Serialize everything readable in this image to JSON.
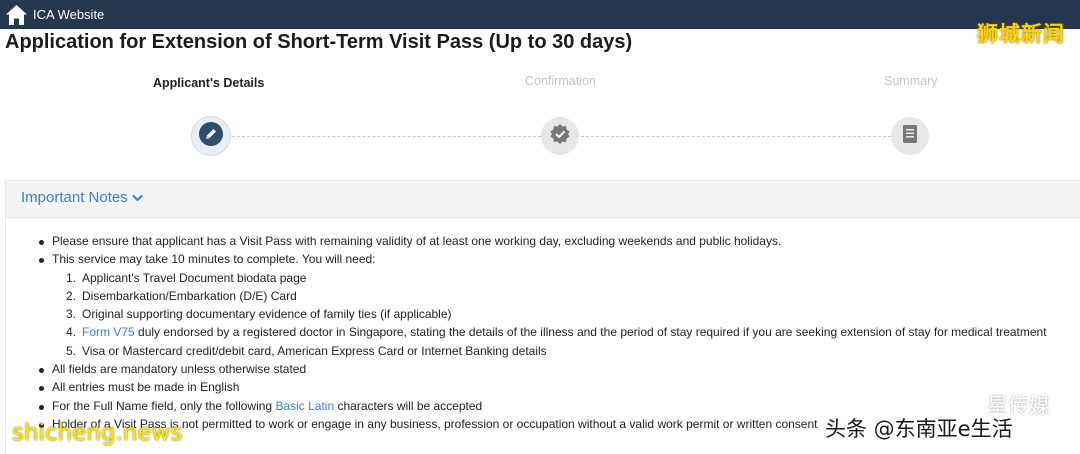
{
  "topbar": {
    "home_label": "ICA Website"
  },
  "watermarks": {
    "top_right": "狮城新闻",
    "mid_right": "星传媒",
    "bottom_left": "shicheng.news",
    "bottom_right": "头条 @东南亚e生活"
  },
  "page": {
    "title": "Application for Extension of Short-Term Visit Pass (Up to 30 days)"
  },
  "steps": [
    {
      "label": "Applicant's Details",
      "state": "active",
      "icon": "pencil-icon"
    },
    {
      "label": "Confirmation",
      "state": "inactive",
      "icon": "check-badge-icon"
    },
    {
      "label": "Summary",
      "state": "inactive",
      "icon": "document-icon"
    }
  ],
  "notes": {
    "toggle_label": "Important Notes",
    "items": [
      "Please ensure that applicant has a Visit Pass with remaining validity of at least one working day, excluding weekends and public holidays.",
      "This service may take 10 minutes to complete. You will need:"
    ],
    "needs": [
      {
        "num": "1.",
        "text": "Applicant's Travel Document biodata page"
      },
      {
        "num": "2.",
        "text": "Disembarkation/Embarkation (D/E) Card"
      },
      {
        "num": "3.",
        "text": "Original supporting documentary evidence of family ties (if applicable)"
      },
      {
        "num": "4.",
        "link": "Form V75",
        "text": " duly endorsed by a registered doctor in Singapore, stating the details of the illness and the period of stay required if you are seeking extension of stay for medical treatment"
      },
      {
        "num": "5.",
        "text": "Visa or Mastercard credit/debit card, American Express Card or Internet Banking details"
      }
    ],
    "more_items": [
      "All fields are mandatory unless otherwise stated",
      "All entries must be made in English"
    ],
    "latin_item": {
      "before": "For the Full Name field, only the following ",
      "link": "Basic Latin",
      "after": " characters will be accepted"
    },
    "last_item": "Holder of a Visit Pass is not permitted to work or engage in any business, profession or occupation without a valid work permit or written consent"
  },
  "colors": {
    "topbar": "#27374d",
    "link": "#3b7fc4",
    "watermark_yellow": "#ffd400"
  }
}
